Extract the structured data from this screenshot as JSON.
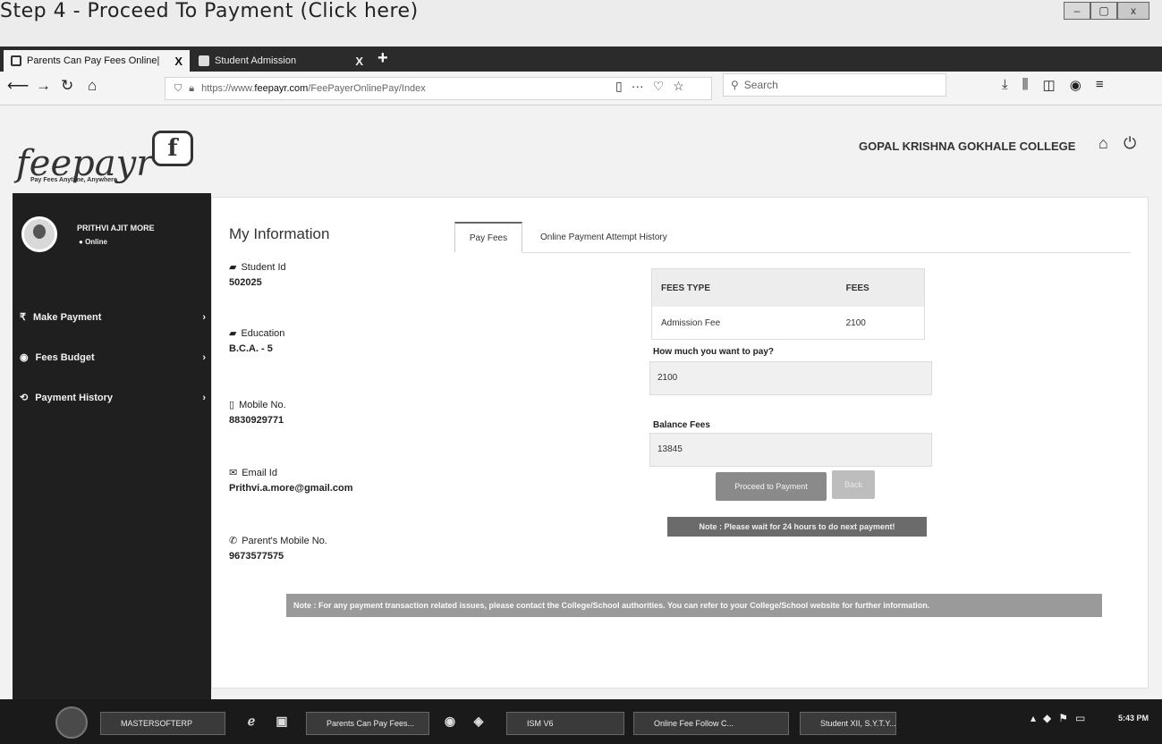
{
  "caption": "Step 4 - Proceed To Payment (Click here)",
  "window": {
    "minimize": "–",
    "maximize": "▢",
    "close": "x"
  },
  "browser": {
    "tabs": [
      {
        "label": "Parents Can Pay Fees Online|",
        "close": "X"
      },
      {
        "label": "Student Admission",
        "close": "X"
      }
    ],
    "new_tab": "+",
    "url_scheme": "https://www.",
    "url_host": "feepayr.com",
    "url_path": "/FeePayerOnlinePay/Index",
    "url_more": "···",
    "search_placeholder": "Search"
  },
  "header": {
    "logo_text": "feepayr",
    "logo_badge": "f",
    "tagline": "Pay Fees Anytime, Anywhere",
    "college_name": "GOPAL KRISHNA GOKHALE COLLEGE"
  },
  "sidebar": {
    "user_name": "PRITHVI AJIT MORE",
    "user_status": "Online",
    "items": [
      {
        "icon": "₹",
        "label": "Make Payment"
      },
      {
        "icon": "◉",
        "label": "Fees Budget"
      },
      {
        "icon": "⟲",
        "label": "Payment History"
      }
    ]
  },
  "info": {
    "title": "My Information",
    "student_id_label": "Student Id",
    "student_id": "502025",
    "education_label": "Education",
    "education": "B.C.A. - 5",
    "mobile_label": "Mobile No.",
    "mobile": "8830929771",
    "email_label": "Email Id",
    "email": "Prithvi.a.more@gmail.com",
    "parent_mobile_label": "Parent's Mobile No.",
    "parent_mobile": "9673577575"
  },
  "tabs": {
    "pay_fees": "Pay Fees",
    "history": "Online Payment Attempt History"
  },
  "fees_table": {
    "headers": [
      "FEES TYPE",
      "FEES"
    ],
    "rows": [
      {
        "type": "Admission Fee",
        "fees": "2100"
      }
    ]
  },
  "form": {
    "pay_label": "How much you want to pay?",
    "pay_value": "2100",
    "balance_label": "Balance Fees",
    "balance_value": "13845",
    "proceed_label": "Proceed to Payment",
    "back_label": "Back",
    "note_wait": "Note : Please wait for 24 hours to do next payment!"
  },
  "note_bottom": "Note : For any payment transaction related issues, please contact the College/School authorities. You can refer to your College/School website for further information.",
  "taskbar": {
    "items": [
      "MASTERSOFTERP",
      "Parents Can Pay Fees...",
      "ISM V6",
      "Online Fee Follow C...",
      "Student XII, S.Y.T.Y...."
    ],
    "clock": "5:43 PM"
  }
}
